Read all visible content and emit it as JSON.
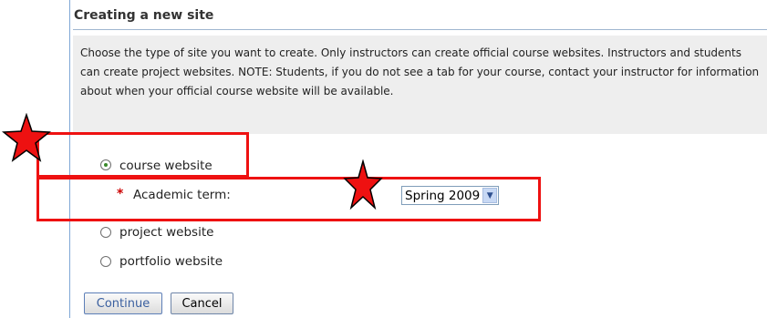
{
  "page": {
    "title": "Creating a new site",
    "instructions": "Choose the type of site you want to create. Only instructors can create official course websites. Instructors and students can create project websites. NOTE: Students, if you do not see a tab for your course, contact your instructor for information about when your official course website will be available."
  },
  "site_types": {
    "course_label": "course website",
    "project_label": "project website",
    "portfolio_label": "portfolio website",
    "selected": "course website"
  },
  "academic_term": {
    "required_marker": "*",
    "label": "Academic term:",
    "selected_value": "Spring 2009"
  },
  "buttons": {
    "continue_label": "Continue",
    "cancel_label": "Cancel"
  },
  "annotations": {
    "highlight_color": "#ee1111",
    "star_icon": "red-star-icon"
  }
}
